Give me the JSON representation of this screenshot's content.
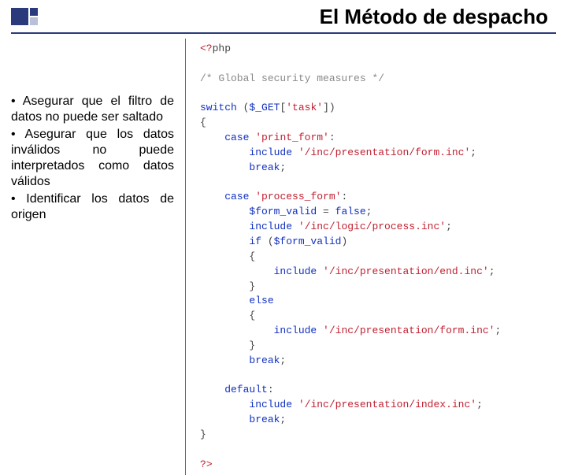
{
  "title": "El Método de despacho",
  "bullets": [
    "• Asegurar que el filtro de datos no puede ser saltado",
    "• Asegurar que los datos inválidos no puede interpretados como datos válidos",
    "• Identificar los datos de origen"
  ],
  "code": {
    "l1a": "<?",
    "l1b": "php",
    "l2": "/* Global security measures */",
    "l3a": "switch",
    "l3b": " (",
    "l3c": "$_GET",
    "l3d": "[",
    "l3e": "'task'",
    "l3f": "])",
    "l4": "{",
    "l5a": "    case",
    "l5b": " ",
    "l5c": "'print_form'",
    "l5d": ":",
    "l6a": "        include",
    "l6b": " ",
    "l6c": "'/inc/presentation/form.inc'",
    "l6d": ";",
    "l7a": "        break",
    "l7b": ";",
    "l8a": "    case",
    "l8b": " ",
    "l8c": "'process_form'",
    "l8d": ":",
    "l9a": "        ",
    "l9b": "$form_valid",
    "l9c": " = ",
    "l9d": "false",
    "l9e": ";",
    "l10a": "        include",
    "l10b": " ",
    "l10c": "'/inc/logic/process.inc'",
    "l10d": ";",
    "l11a": "        if",
    "l11b": " (",
    "l11c": "$form_valid",
    "l11d": ")",
    "l12": "        {",
    "l13a": "            include",
    "l13b": " ",
    "l13c": "'/inc/presentation/end.inc'",
    "l13d": ";",
    "l14": "        }",
    "l15a": "        else",
    "l16": "        {",
    "l17a": "            include",
    "l17b": " ",
    "l17c": "'/inc/presentation/form.inc'",
    "l17d": ";",
    "l18": "        }",
    "l19a": "        break",
    "l19b": ";",
    "l20a": "    default",
    "l20b": ":",
    "l21a": "        include",
    "l21b": " ",
    "l21c": "'/inc/presentation/index.inc'",
    "l21d": ";",
    "l22a": "        break",
    "l22b": ";",
    "l23": "}",
    "l24a": "?",
    "l24b": ">"
  }
}
